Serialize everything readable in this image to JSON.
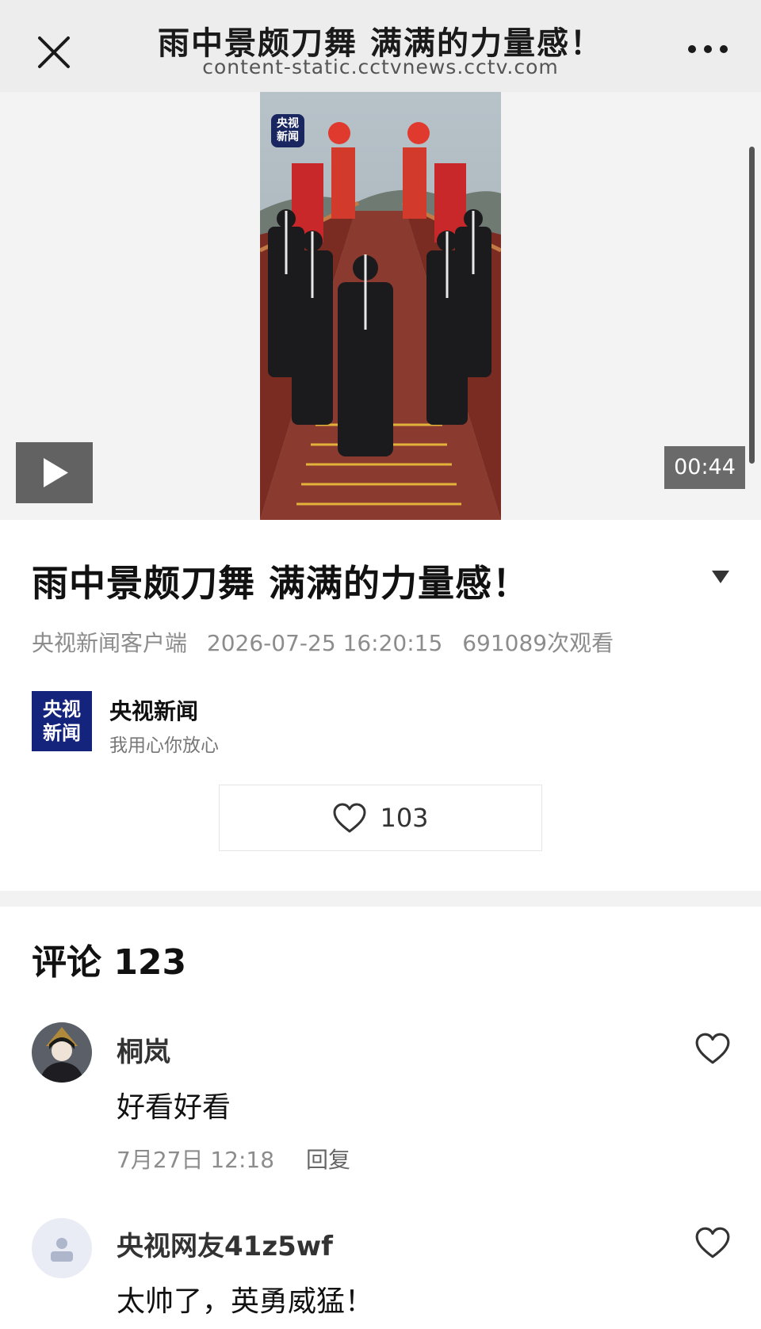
{
  "top_bar": {
    "title": "雨中景颇刀舞 满满的力量感！",
    "url": "content-static.cctvnews.cctv.com"
  },
  "video": {
    "duration": "00:44",
    "watermark_line1": "央视",
    "watermark_line2": "新闻"
  },
  "article": {
    "title": "雨中景颇刀舞 满满的力量感！",
    "source": "央视新闻客户端",
    "datetime": "2026-07-25 16:20:15",
    "views": "691089次观看"
  },
  "author": {
    "logo_line1": "央视",
    "logo_line2": "新闻",
    "name": "央视新闻",
    "slogan": "我用心你放心"
  },
  "like": {
    "count": "103",
    "icon": "heart-icon"
  },
  "comments": {
    "header": "评论 123",
    "items": [
      {
        "user": "桐岚",
        "text": "好看好看",
        "time": "7月27日 12:18",
        "reply_label": "回复"
      },
      {
        "user": "央视网友41z5wf",
        "text": "太帅了，英勇威猛！"
      }
    ]
  },
  "colors": {
    "top_bar_bg": "#ededed",
    "cctv_blue": "#14237c",
    "meta_gray": "#8c8c8c"
  }
}
